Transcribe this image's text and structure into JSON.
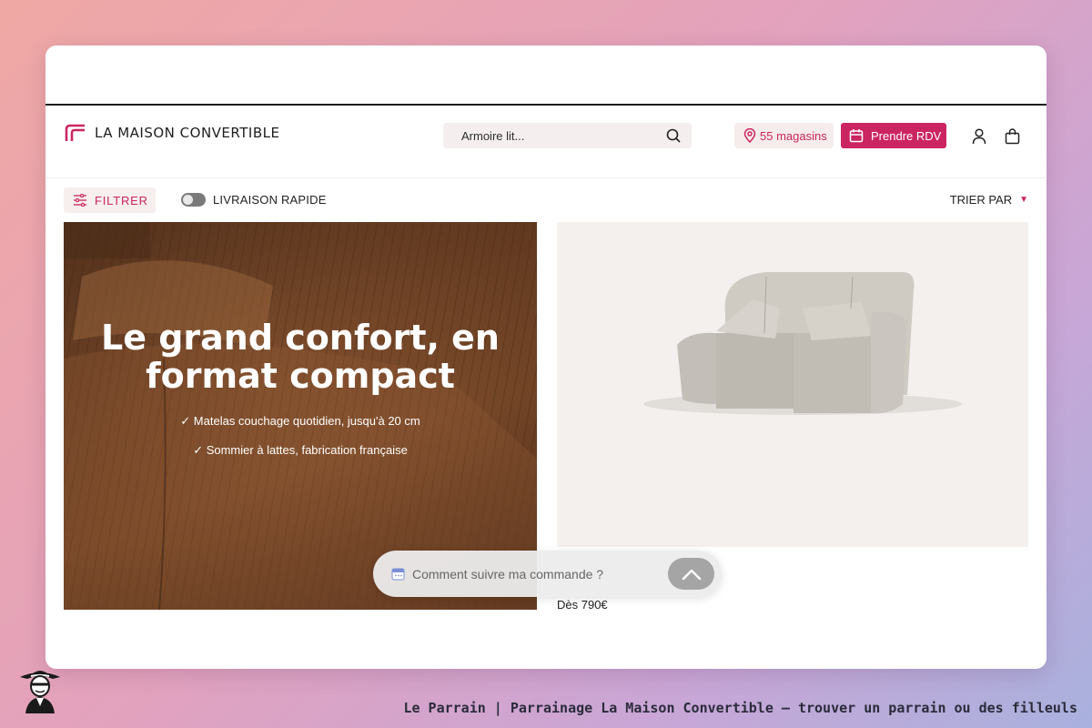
{
  "header": {
    "logo_text": "LA MAISON CONVERTIBLE",
    "search_value": "Armoire lit...",
    "stores_label": "55 magasins",
    "rdv_label": "Prendre RDV"
  },
  "toolbar": {
    "filter_label": "FILTRER",
    "fast_delivery_label": "LIVRAISON RAPIDE",
    "sort_label": "TRIER PAR"
  },
  "promo": {
    "title_line1": "Le grand confort, en",
    "title_line2": "format compact",
    "bullets": [
      "Matelas couchage quotidien, jusqu'à 20 cm",
      "Sommier à lattes, fabrication française"
    ]
  },
  "product": {
    "price": "Dès 790€"
  },
  "chat": {
    "placeholder": "Comment suivre ma commande ?"
  },
  "caption": "Le Parrain | Parrainage La Maison Convertible — trouver un parrain ou des filleuls",
  "colors": {
    "brand": "#cb2561",
    "brand_light_bg": "#f7eeee"
  },
  "icons": {
    "search": "search-icon",
    "pin": "map-pin-icon",
    "calendar": "calendar-icon",
    "user": "user-icon",
    "bag": "bag-icon",
    "filter": "filter-sliders-icon",
    "chevron": "chevron-down-icon",
    "chat_up": "chevron-up-icon"
  }
}
